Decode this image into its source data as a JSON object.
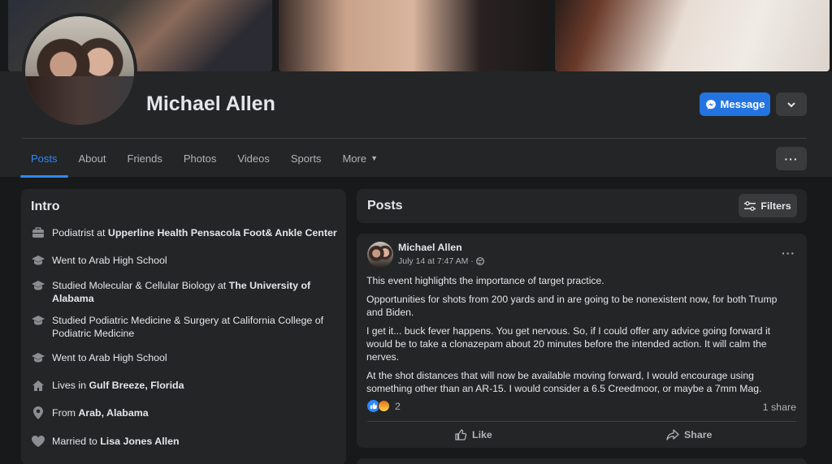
{
  "profile": {
    "name": "Michael Allen",
    "message_label": "Message"
  },
  "tabs": [
    {
      "label": "Posts",
      "active": true
    },
    {
      "label": "About"
    },
    {
      "label": "Friends"
    },
    {
      "label": "Photos"
    },
    {
      "label": "Videos"
    },
    {
      "label": "Sports"
    },
    {
      "label": "More"
    }
  ],
  "intro": {
    "title": "Intro",
    "items": [
      {
        "icon": "briefcase-icon",
        "prefix": "Podiatrist at ",
        "bold": "Upperline Health Pensacola Foot& Ankle Center"
      },
      {
        "icon": "graduation-cap-icon",
        "prefix": "Went to Arab High School",
        "bold": ""
      },
      {
        "icon": "graduation-cap-icon",
        "prefix": "Studied Molecular & Cellular Biology at ",
        "bold": "The University of Alabama"
      },
      {
        "icon": "graduation-cap-icon",
        "prefix": "Studied Podiatric Medicine & Surgery at California College of Podiatric Medicine",
        "bold": ""
      },
      {
        "icon": "graduation-cap-icon",
        "prefix": "Went to Arab High School",
        "bold": ""
      },
      {
        "icon": "home-icon",
        "prefix": "Lives in ",
        "bold": "Gulf Breeze, Florida"
      },
      {
        "icon": "location-pin-icon",
        "prefix": "From ",
        "bold": "Arab, Alabama"
      },
      {
        "icon": "heart-icon",
        "prefix": "Married to ",
        "bold": "Lisa Jones Allen"
      }
    ]
  },
  "posts": {
    "title": "Posts",
    "filters_label": "Filters",
    "post": {
      "author": "Michael Allen",
      "date": "July 14 at 7:47 AM ·",
      "paragraphs": [
        "This event highlights the importance of target practice.",
        "Opportunities for shots from 200 yards and in are going to be nonexistent now, for both Trump and Biden.",
        "I get it... buck fever happens.  You get nervous.  So, if I could offer any advice going forward it would be to take a clonazepam about 20 minutes before the intended action.  It will calm the nerves.",
        "At the shot distances that will now be available moving forward, I would encourage using something other than an AR-15.  I would consider a 6.5 Creedmoor, or maybe a 7mm Mag."
      ],
      "reaction_count": "2",
      "shares": "1 share",
      "like_label": "Like",
      "share_label": "Share"
    }
  },
  "colors": {
    "accent": "#2d88ff",
    "message_button": "#2374e1",
    "card": "#242526",
    "background": "#18191a"
  }
}
